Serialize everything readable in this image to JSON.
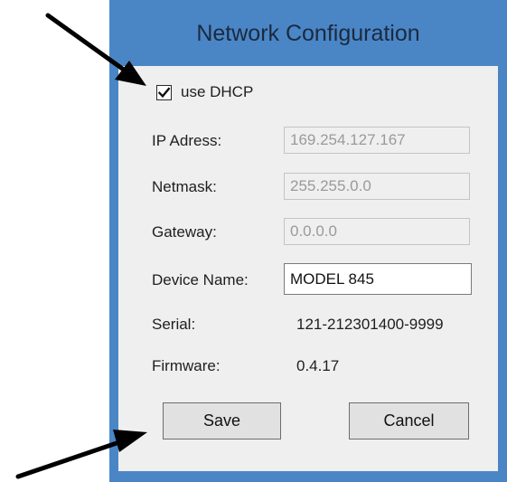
{
  "window": {
    "title": "Network Configuration"
  },
  "form": {
    "dhcp": {
      "label": "use DHCP",
      "checked": true
    },
    "ip": {
      "label": "IP Adress:",
      "value": "169.254.127.167"
    },
    "netmask": {
      "label": "Netmask:",
      "value": "255.255.0.0"
    },
    "gateway": {
      "label": "Gateway:",
      "value": "0.0.0.0"
    },
    "device_name": {
      "label": "Device Name:",
      "value": "MODEL 845"
    },
    "serial": {
      "label": "Serial:",
      "value": "121-212301400-9999"
    },
    "firmware": {
      "label": "Firmware:",
      "value": "0.4.17"
    }
  },
  "buttons": {
    "save": "Save",
    "cancel": "Cancel"
  },
  "colors": {
    "window_frame": "#4a86c6",
    "client_background": "#efefef",
    "annotation_arrow": "#000000"
  }
}
